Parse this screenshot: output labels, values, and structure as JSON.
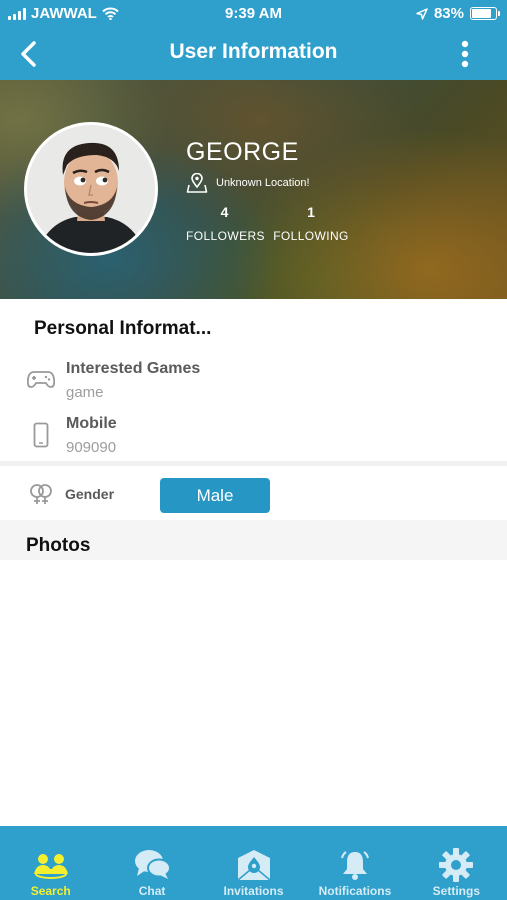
{
  "status_bar": {
    "carrier": "JAWWAL",
    "time": "9:39 AM",
    "battery": "83%",
    "battery_level": 0.83
  },
  "nav": {
    "title": "User Information",
    "back_icon": "chevron-left-icon",
    "more_icon": "more-vertical-icon"
  },
  "profile": {
    "name": "GEORGE",
    "location": "Unknown Location!",
    "followers_count": "4",
    "followers_label": "FOLLOWERS",
    "following_count": "1",
    "following_label": "FOLLOWING"
  },
  "personal_info": {
    "title": "Personal Informat...",
    "fields": [
      {
        "icon": "gamepad-icon",
        "label": "Interested Games",
        "value": "game"
      },
      {
        "icon": "mobile-phone-icon",
        "label": "Mobile",
        "value": "909090"
      }
    ],
    "gender_label": "Gender",
    "gender_value": "Male"
  },
  "photos": {
    "title": "Photos"
  },
  "tabs": [
    {
      "label": "Search",
      "icon": "search-users-icon",
      "active": true
    },
    {
      "label": "Chat",
      "icon": "chat-bubbles-icon",
      "active": false
    },
    {
      "label": "Invitations",
      "icon": "invitation-envelope-icon",
      "active": false
    },
    {
      "label": "Notifications",
      "icon": "bell-icon",
      "active": false
    },
    {
      "label": "Settings",
      "icon": "gear-icon",
      "active": false
    }
  ],
  "colors": {
    "primary": "#2f9fcb",
    "button": "#2697c4",
    "active_tab": "#f4ef2f",
    "inactive_tab": "#d5ecf6"
  }
}
